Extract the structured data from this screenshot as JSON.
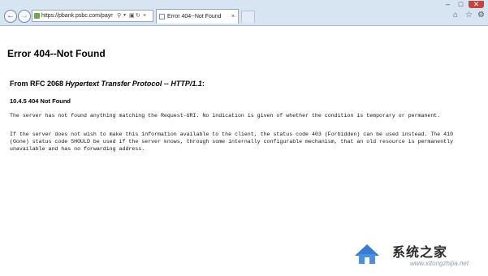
{
  "browser": {
    "address_url": "https://pbank.psbc.com/payment/main",
    "tab_title": "Error 404--Not Found",
    "tab_close": "×",
    "window_min": "–",
    "window_max": "□",
    "window_close": "✕",
    "icons": {
      "back": "back-arrow-icon",
      "forward": "forward-arrow-icon",
      "search": "search-icon",
      "dropdown": "chevron-down-icon",
      "lock": "lock-icon",
      "refresh": "refresh-icon",
      "stop": "close-icon",
      "home": "home-icon",
      "favorites": "star-icon",
      "settings": "gear-icon"
    }
  },
  "page": {
    "title": "Error 404--Not Found",
    "rfc_prefix": "From RFC 2068 ",
    "rfc_italic": "Hypertext Transfer Protocol -- HTTP/1.1",
    "rfc_suffix": ":",
    "status_heading": "10.4.5 404 Not Found",
    "paragraph_1": "The server has not found anything matching the Request-URI. No indication is given of whether the condition is temporary or permanent.",
    "paragraph_2": "If the server does not wish to make this information available to the client, the status code 403 (Forbidden) can be used instead. The 410 (Gone) status code SHOULD be used if the server knows, through some internally configurable mechanism, that an old resource is permanently unavailable and has no forwarding address."
  },
  "watermark": {
    "text": "系统之家",
    "url": "www.xitongzhijia.net"
  },
  "colors": {
    "chrome_bg": "#d7e4f2",
    "close_btn": "#c7443a"
  }
}
